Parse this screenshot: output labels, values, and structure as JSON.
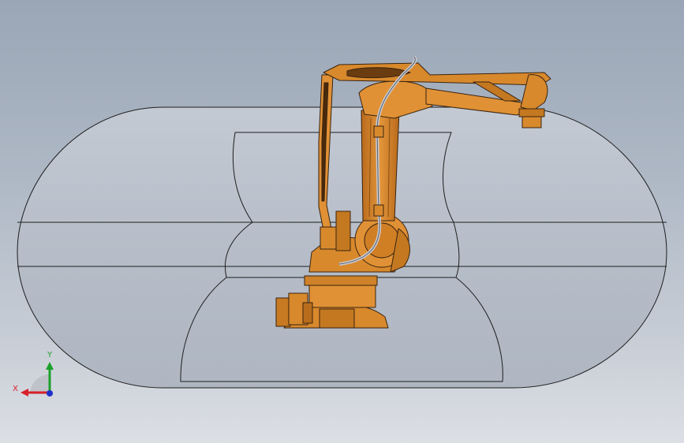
{
  "viewport": {
    "background_top": "#9aa6b6",
    "background_bottom": "#dcdfe4"
  },
  "work_envelope": {
    "fill": "#b9c0cb",
    "stroke": "#1e1e1e"
  },
  "robot": {
    "body_color": "#d8892c",
    "outline_color": "#3a2410",
    "cable_color": "#c9ccd4"
  },
  "triad": {
    "x_label": "X",
    "y_label": "Y",
    "x_color": "#d8202a",
    "y_color": "#1aa02a",
    "z_color": "#2030c8"
  }
}
